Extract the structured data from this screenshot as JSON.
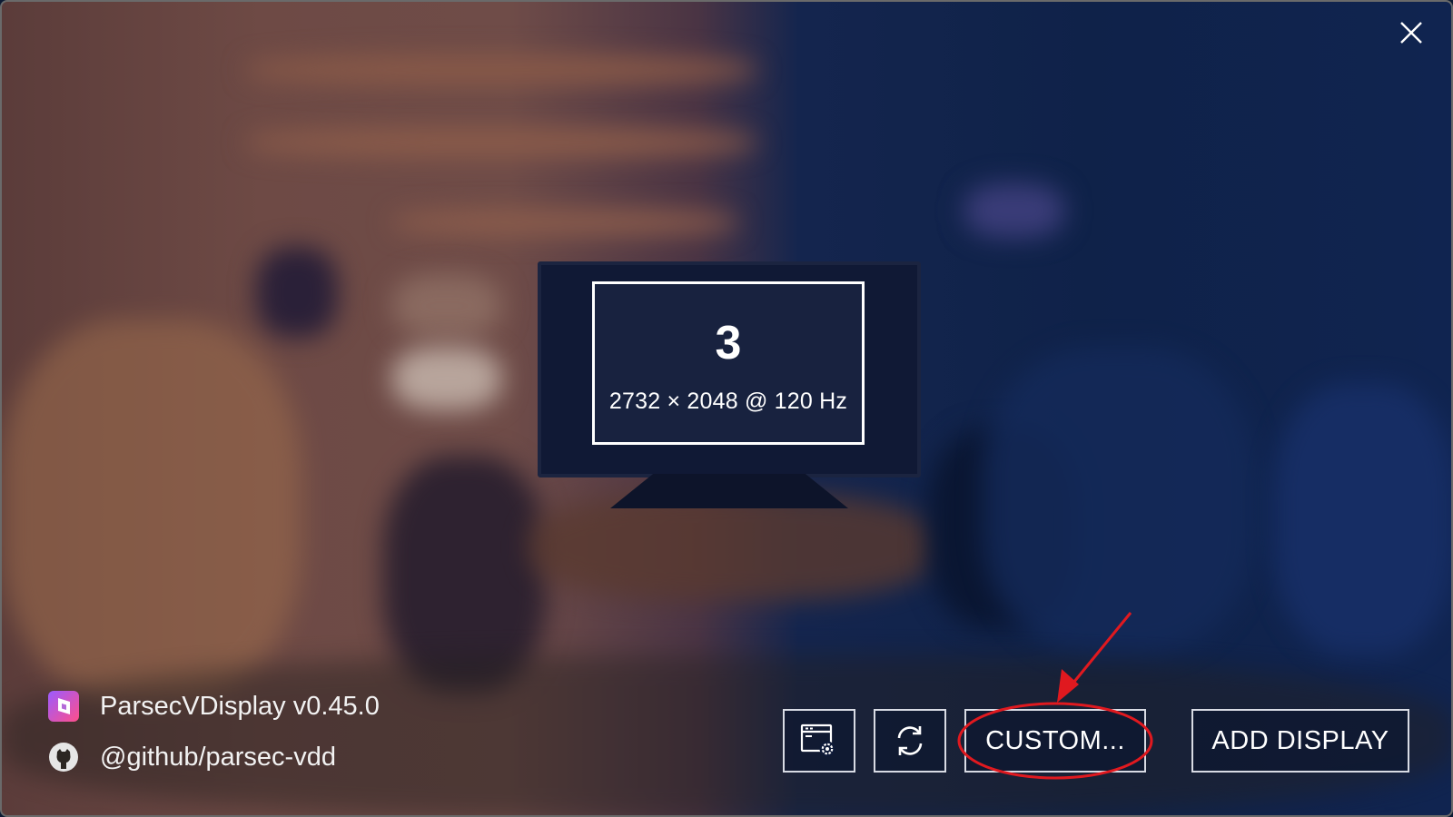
{
  "window": {
    "close_icon": "close-icon"
  },
  "display": {
    "number": "3",
    "mode": "2732 × 2048 @ 120 Hz"
  },
  "app": {
    "name": "ParsecVDisplay v0.45.0",
    "logo_icon": "parsec-logo-icon",
    "github": "@github/parsec-vdd",
    "github_icon": "github-icon"
  },
  "toolbar": {
    "settings_icon": "display-settings-icon",
    "refresh_icon": "refresh-icon",
    "custom_label": "CUSTOM...",
    "add_label": "ADD DISPLAY"
  },
  "colors": {
    "annotation_red": "#e0191f",
    "button_border": "#d8dbe4"
  }
}
